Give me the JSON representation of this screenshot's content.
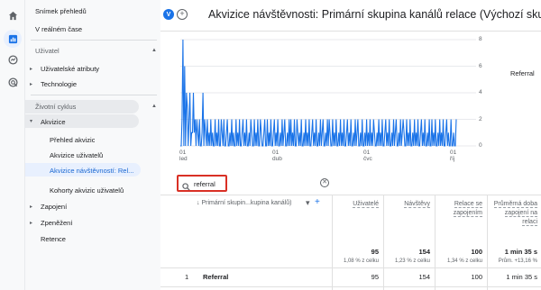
{
  "nav": {
    "items": [
      {
        "label": "Snímek přehledů"
      },
      {
        "label": "V reálném čase"
      },
      {
        "label": "Uživatel"
      },
      {
        "label": "Uživatelské atributy"
      },
      {
        "label": "Technologie"
      },
      {
        "label": "Životní cyklus"
      },
      {
        "label": "Akvizice"
      },
      {
        "label": "Přehled akvizic"
      },
      {
        "label": "Akvizice uživatelů"
      },
      {
        "label": "Akvizice návštěvností: Rel..."
      },
      {
        "label": "Kohorty akvizic uživatelů"
      },
      {
        "label": "Zapojení"
      },
      {
        "label": "Zpeněžení"
      },
      {
        "label": "Retence"
      }
    ]
  },
  "header": {
    "badge": "V",
    "add": "+",
    "title": "Akvizice návštěvnosti: Primární skupina kanálů relace (Výchozí skupina ka"
  },
  "chart": {
    "y_ticks_left": [
      "8",
      "6",
      "4",
      "2",
      "0"
    ],
    "y_ticks_right": [
      "8",
      "6",
      "4",
      "2",
      "0"
    ],
    "x_ticks": [
      {
        "day": "01",
        "month": "led"
      },
      {
        "day": "01",
        "month": "dub"
      },
      {
        "day": "01",
        "month": "čvc"
      },
      {
        "day": "01",
        "month": "říj"
      }
    ],
    "legend": "Referral",
    "colors": {
      "series": "#1a73e8"
    }
  },
  "chart_data": {
    "type": "line",
    "series": [
      {
        "name": "Referral",
        "values": [
          0,
          0,
          2,
          8,
          0,
          6,
          0,
          4,
          3,
          0,
          2,
          4,
          0,
          1,
          1,
          4,
          1,
          2,
          0,
          2,
          1,
          0,
          2,
          0,
          0,
          1,
          4,
          0,
          2,
          1,
          0,
          2,
          0,
          1,
          0,
          2,
          0,
          1,
          0,
          0,
          2,
          0,
          1,
          0,
          2,
          0,
          0,
          2,
          1,
          0,
          2,
          0,
          0,
          1,
          2,
          0,
          0,
          1,
          0,
          2,
          0,
          1,
          0,
          0,
          2,
          0,
          1,
          0,
          2,
          0,
          0,
          1,
          2,
          0,
          1,
          0,
          2,
          0,
          0,
          1,
          0,
          2,
          1,
          0,
          0,
          2,
          0,
          1,
          0,
          2,
          0,
          0,
          2,
          1,
          0,
          0,
          1,
          2,
          0,
          0,
          2,
          0,
          1,
          0,
          2,
          0,
          0,
          1,
          2,
          0,
          1,
          0,
          2,
          0,
          0,
          1,
          0,
          2,
          0,
          1,
          2,
          0,
          0,
          1,
          0,
          2,
          0,
          2,
          0,
          1,
          0,
          2,
          0,
          0,
          2,
          1,
          0,
          1,
          0,
          2,
          0,
          0,
          1,
          0,
          2,
          0,
          1,
          0,
          2,
          0,
          0,
          1,
          2,
          0,
          1,
          0,
          2,
          0,
          0,
          1,
          0,
          2,
          0,
          1,
          2,
          0,
          0,
          1,
          0,
          2,
          0,
          2,
          1,
          0,
          0,
          2,
          0,
          1,
          0,
          2,
          0,
          0,
          1,
          0,
          2,
          0,
          1,
          0,
          2,
          0,
          0,
          1,
          2,
          0,
          1,
          0,
          2,
          0,
          0,
          1,
          0,
          2,
          0,
          1,
          2,
          0,
          0,
          1,
          0,
          2,
          0,
          0,
          1,
          0,
          2,
          0,
          1,
          0,
          2,
          0,
          1,
          0,
          2,
          1,
          0,
          0,
          1,
          0,
          2,
          0,
          1,
          0,
          2,
          0,
          0,
          1,
          2,
          0,
          1,
          0,
          2,
          0,
          0,
          1,
          0,
          2,
          0,
          1,
          2,
          0,
          0,
          1,
          0,
          2,
          0,
          1,
          2,
          1,
          0,
          0,
          2,
          0,
          1,
          0,
          2,
          0,
          0,
          1,
          0,
          2,
          0,
          1,
          0,
          2,
          0,
          0,
          1,
          2,
          0,
          1,
          0,
          2,
          0,
          0,
          1,
          0,
          2,
          0,
          0,
          2,
          0,
          1,
          0,
          2,
          0,
          0,
          1,
          0,
          2,
          0,
          1,
          0,
          2,
          0,
          0,
          1,
          2,
          0,
          1,
          0,
          0,
          2,
          0,
          0,
          1,
          0,
          0,
          2
        ]
      }
    ],
    "ylim": [
      0,
      8
    ]
  },
  "search": {
    "value": "referral"
  },
  "table": {
    "dim_header": "Primární skupin...kupina kanálů)",
    "columns": [
      {
        "label": "Uživatelé",
        "total": "95",
        "total_sub": "1,08 % z celku",
        "row": "95"
      },
      {
        "label": "Návštěvy",
        "total": "154",
        "total_sub": "1,23 % z celku",
        "row": "154"
      },
      {
        "label": "Relace se zapojením",
        "total": "100",
        "total_sub": "1,34 % z celku",
        "row": "100"
      },
      {
        "label": "Průměrná doba zapojení na relaci",
        "total": "1 min 35 s",
        "total_sub": "Prům. +13,16 %",
        "row": "1 min 35 s"
      }
    ],
    "rows": [
      {
        "index": "1",
        "name": "Referral"
      }
    ]
  }
}
